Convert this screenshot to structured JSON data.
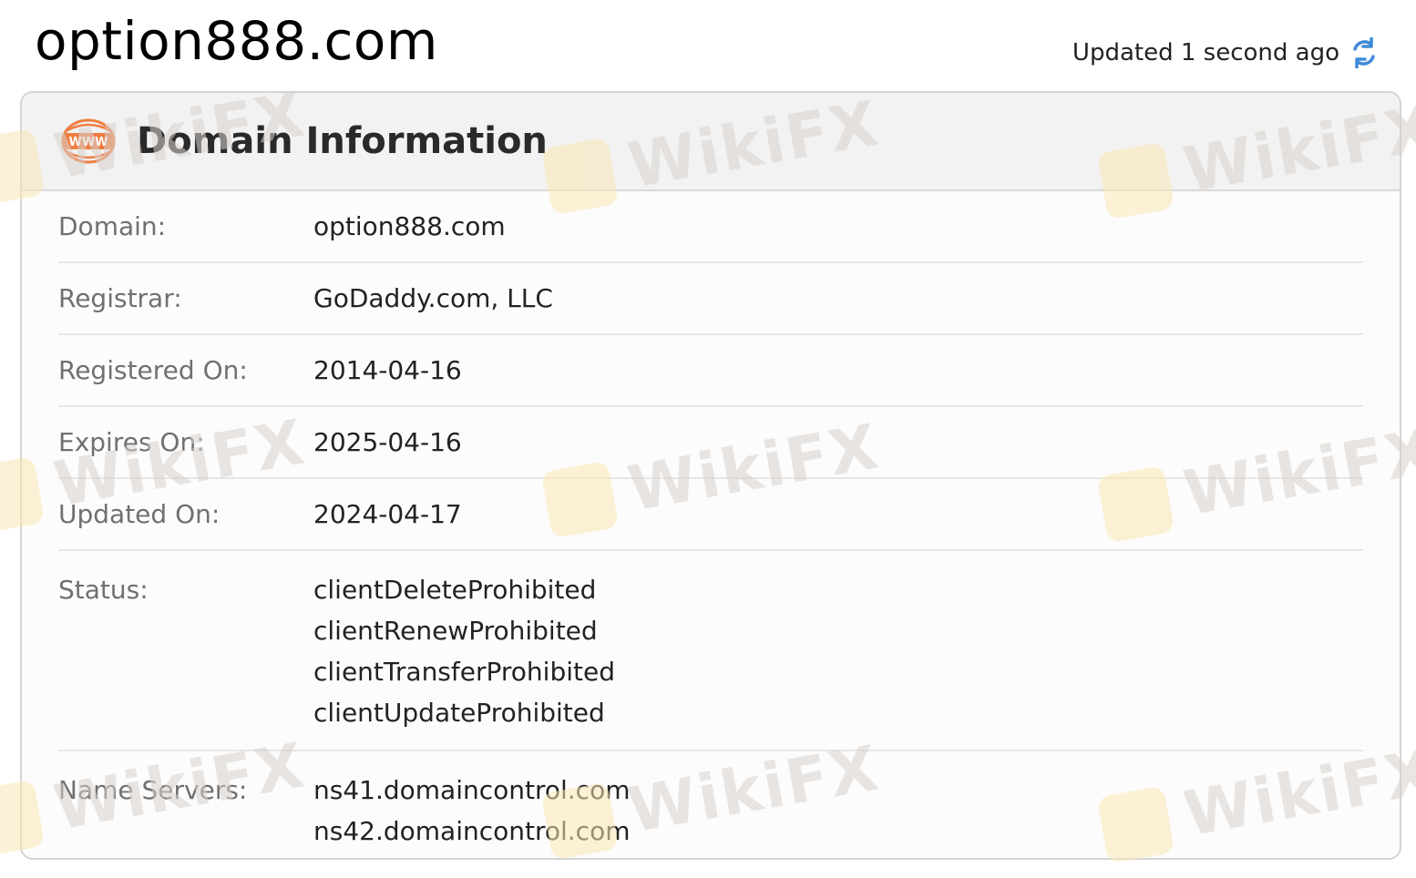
{
  "header": {
    "site_title": "option888.com",
    "updated_text": "Updated 1 second ago"
  },
  "card": {
    "title": "Domain Information",
    "rows": {
      "domain": {
        "label": "Domain:",
        "value": "option888.com"
      },
      "registrar": {
        "label": "Registrar:",
        "value": "GoDaddy.com, LLC"
      },
      "registered_on": {
        "label": "Registered On:",
        "value": "2014-04-16"
      },
      "expires_on": {
        "label": "Expires On:",
        "value": "2025-04-16"
      },
      "updated_on": {
        "label": "Updated On:",
        "value": "2024-04-17"
      },
      "status": {
        "label": "Status:",
        "values": [
          "clientDeleteProhibited",
          "clientRenewProhibited",
          "clientTransferProhibited",
          "clientUpdateProhibited"
        ]
      },
      "name_servers": {
        "label": "Name Servers:",
        "values": [
          "ns41.domaincontrol.com",
          "ns42.domaincontrol.com"
        ]
      }
    }
  },
  "watermark": {
    "text": "WikiFX"
  },
  "icons": {
    "refresh": "refresh-icon",
    "www": "www-globe-icon"
  },
  "colors": {
    "accent_blue": "#3f8ad8",
    "www_orange": "#ef7d42",
    "watermark_logo": "#fbe7b5"
  }
}
